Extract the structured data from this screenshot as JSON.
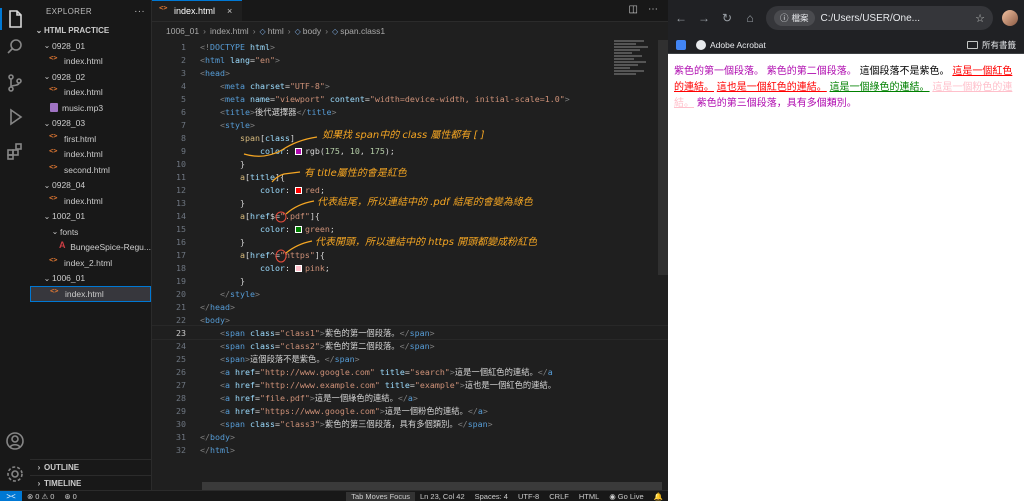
{
  "explorer": {
    "title": "EXPLORER",
    "more": "···",
    "workspace": "HTML PRACTICE",
    "tree": [
      {
        "label": "0928_01",
        "type": "folder",
        "indent": 1
      },
      {
        "label": "index.html",
        "type": "html",
        "indent": 2
      },
      {
        "label": "0928_02",
        "type": "folder",
        "indent": 1
      },
      {
        "label": "index.html",
        "type": "html",
        "indent": 2
      },
      {
        "label": "music.mp3",
        "type": "music",
        "indent": 2
      },
      {
        "label": "0928_03",
        "type": "folder",
        "indent": 1
      },
      {
        "label": "first.html",
        "type": "html",
        "indent": 2
      },
      {
        "label": "index.html",
        "type": "html",
        "indent": 2
      },
      {
        "label": "second.html",
        "type": "html",
        "indent": 2
      },
      {
        "label": "0928_04",
        "type": "folder",
        "indent": 1
      },
      {
        "label": "index.html",
        "type": "html",
        "indent": 2
      },
      {
        "label": "1002_01",
        "type": "folder",
        "indent": 1
      },
      {
        "label": "fonts",
        "type": "folder",
        "indent": 2
      },
      {
        "label": "BungeeSpice-Regu...",
        "type": "font",
        "indent": 3
      },
      {
        "label": "index_2.html",
        "type": "html",
        "indent": 2
      },
      {
        "label": "1006_01",
        "type": "folder",
        "indent": 1
      },
      {
        "label": "index.html",
        "type": "html",
        "indent": 2,
        "selected": true
      }
    ],
    "outline": "OUTLINE",
    "timeline": "TIMELINE"
  },
  "editor": {
    "tab_label": "index.html",
    "tab_close": "×",
    "breadcrumb": [
      "1006_01",
      "index.html",
      "html",
      "body",
      "span.class1"
    ],
    "current_line": 23,
    "lines": [
      [
        [
          "t-br",
          "<!"
        ],
        [
          "t-tag",
          "DOCTYPE"
        ],
        [
          "t-attr",
          " html"
        ],
        [
          "t-br",
          ">"
        ]
      ],
      [
        [
          "t-br",
          "<"
        ],
        [
          "t-tag",
          "html"
        ],
        [
          "t-attr",
          " lang"
        ],
        [
          "t-txt",
          "="
        ],
        [
          "t-str",
          "\"en\""
        ],
        [
          "t-br",
          ">"
        ]
      ],
      [
        [
          "t-br",
          "<"
        ],
        [
          "t-tag",
          "head"
        ],
        [
          "t-br",
          ">"
        ]
      ],
      [
        [
          "t-txt",
          "    "
        ],
        [
          "t-br",
          "<"
        ],
        [
          "t-tag",
          "meta"
        ],
        [
          "t-attr",
          " charset"
        ],
        [
          "t-txt",
          "="
        ],
        [
          "t-str",
          "\"UTF-8\""
        ],
        [
          "t-br",
          ">"
        ]
      ],
      [
        [
          "t-txt",
          "    "
        ],
        [
          "t-br",
          "<"
        ],
        [
          "t-tag",
          "meta"
        ],
        [
          "t-attr",
          " name"
        ],
        [
          "t-txt",
          "="
        ],
        [
          "t-str",
          "\"viewport\""
        ],
        [
          "t-attr",
          " content"
        ],
        [
          "t-txt",
          "="
        ],
        [
          "t-str",
          "\"width=device-width, initial-scale=1.0\""
        ],
        [
          "t-br",
          ">"
        ]
      ],
      [
        [
          "t-txt",
          "    "
        ],
        [
          "t-br",
          "<"
        ],
        [
          "t-tag",
          "title"
        ],
        [
          "t-br",
          ">"
        ],
        [
          "t-txt",
          "後代選擇器"
        ],
        [
          "t-br",
          "</"
        ],
        [
          "t-tag",
          "title"
        ],
        [
          "t-br",
          ">"
        ]
      ],
      [
        [
          "t-txt",
          "    "
        ],
        [
          "t-br",
          "<"
        ],
        [
          "t-tag",
          "style"
        ],
        [
          "t-br",
          ">"
        ]
      ],
      [
        [
          "t-txt",
          "        "
        ],
        [
          "t-sel",
          "span"
        ],
        [
          "t-txt",
          "["
        ],
        [
          "t-attr",
          "class"
        ],
        [
          "t-txt",
          "]"
        ]
      ],
      [
        [
          "t-txt",
          "            "
        ],
        [
          "t-prop",
          "color"
        ],
        [
          "t-txt",
          ": "
        ],
        [
          "swatch",
          "#af0aaf"
        ],
        [
          "t-txt",
          "rgb("
        ],
        [
          "t-num",
          "175"
        ],
        [
          "t-txt",
          ", "
        ],
        [
          "t-num",
          "10"
        ],
        [
          "t-txt",
          ", "
        ],
        [
          "t-num",
          "175"
        ],
        [
          "t-txt",
          ");"
        ]
      ],
      [
        [
          "t-txt",
          "        }"
        ]
      ],
      [
        [
          "t-txt",
          "        "
        ],
        [
          "t-sel",
          "a"
        ],
        [
          "t-txt",
          "["
        ],
        [
          "t-attr",
          "title"
        ],
        [
          "t-txt",
          "]{"
        ]
      ],
      [
        [
          "t-txt",
          "            "
        ],
        [
          "t-prop",
          "color"
        ],
        [
          "t-txt",
          ": "
        ],
        [
          "swatch",
          "#ff0000"
        ],
        [
          "t-str",
          "red"
        ],
        [
          "t-txt",
          ";"
        ]
      ],
      [
        [
          "t-txt",
          "        }"
        ]
      ],
      [
        [
          "t-txt",
          "        "
        ],
        [
          "t-sel",
          "a"
        ],
        [
          "t-txt",
          "["
        ],
        [
          "t-attr",
          "href"
        ],
        [
          "t-txt",
          "$="
        ],
        [
          "t-str",
          "\".pdf\""
        ],
        [
          "t-txt",
          "]{"
        ]
      ],
      [
        [
          "t-txt",
          "            "
        ],
        [
          "t-prop",
          "color"
        ],
        [
          "t-txt",
          ": "
        ],
        [
          "swatch",
          "#008000"
        ],
        [
          "t-str",
          "green"
        ],
        [
          "t-txt",
          ";"
        ]
      ],
      [
        [
          "t-txt",
          "        }"
        ]
      ],
      [
        [
          "t-txt",
          "        "
        ],
        [
          "t-sel",
          "a"
        ],
        [
          "t-txt",
          "["
        ],
        [
          "t-attr",
          "href"
        ],
        [
          "t-txt",
          "^="
        ],
        [
          "t-str",
          "\"https\""
        ],
        [
          "t-txt",
          "]{"
        ]
      ],
      [
        [
          "t-txt",
          "            "
        ],
        [
          "t-prop",
          "color"
        ],
        [
          "t-txt",
          ": "
        ],
        [
          "swatch",
          "#ffc0cb"
        ],
        [
          "t-str",
          "pink"
        ],
        [
          "t-txt",
          ";"
        ]
      ],
      [
        [
          "t-txt",
          "        }"
        ]
      ],
      [
        [
          "t-txt",
          "    "
        ],
        [
          "t-br",
          "</"
        ],
        [
          "t-tag",
          "style"
        ],
        [
          "t-br",
          ">"
        ]
      ],
      [
        [
          "t-br",
          "</"
        ],
        [
          "t-tag",
          "head"
        ],
        [
          "t-br",
          ">"
        ]
      ],
      [
        [
          "t-br",
          "<"
        ],
        [
          "t-tag",
          "body"
        ],
        [
          "t-br",
          ">"
        ]
      ],
      [
        [
          "t-txt",
          "    "
        ],
        [
          "t-br",
          "<"
        ],
        [
          "t-tag",
          "span"
        ],
        [
          "t-attr",
          " class"
        ],
        [
          "t-txt",
          "="
        ],
        [
          "t-str",
          "\"class1\""
        ],
        [
          "t-br",
          ">"
        ],
        [
          "t-txt",
          "紫色的第一個段落。"
        ],
        [
          "t-br",
          "</"
        ],
        [
          "t-tag",
          "span"
        ],
        [
          "t-br",
          ">"
        ]
      ],
      [
        [
          "t-txt",
          "    "
        ],
        [
          "t-br",
          "<"
        ],
        [
          "t-tag",
          "span"
        ],
        [
          "t-attr",
          " class"
        ],
        [
          "t-txt",
          "="
        ],
        [
          "t-str",
          "\"class2\""
        ],
        [
          "t-br",
          ">"
        ],
        [
          "t-txt",
          "紫色的第二個段落。"
        ],
        [
          "t-br",
          "</"
        ],
        [
          "t-tag",
          "span"
        ],
        [
          "t-br",
          ">"
        ]
      ],
      [
        [
          "t-txt",
          "    "
        ],
        [
          "t-br",
          "<"
        ],
        [
          "t-tag",
          "span"
        ],
        [
          "t-br",
          ">"
        ],
        [
          "t-txt",
          "這個段落不是紫色。"
        ],
        [
          "t-br",
          "</"
        ],
        [
          "t-tag",
          "span"
        ],
        [
          "t-br",
          ">"
        ]
      ],
      [
        [
          "t-txt",
          "    "
        ],
        [
          "t-br",
          "<"
        ],
        [
          "t-tag",
          "a"
        ],
        [
          "t-attr",
          " href"
        ],
        [
          "t-txt",
          "="
        ],
        [
          "t-str",
          "\"http://www.google.com\""
        ],
        [
          "t-attr",
          " title"
        ],
        [
          "t-txt",
          "="
        ],
        [
          "t-str",
          "\"search\""
        ],
        [
          "t-br",
          ">"
        ],
        [
          "t-txt",
          "這是一個紅色的連結。"
        ],
        [
          "t-br",
          "</"
        ],
        [
          "t-tag",
          "a"
        ]
      ],
      [
        [
          "t-txt",
          "    "
        ],
        [
          "t-br",
          "<"
        ],
        [
          "t-tag",
          "a"
        ],
        [
          "t-attr",
          " href"
        ],
        [
          "t-txt",
          "="
        ],
        [
          "t-str",
          "\"http://www.example.com\""
        ],
        [
          "t-attr",
          " title"
        ],
        [
          "t-txt",
          "="
        ],
        [
          "t-str",
          "\"example\""
        ],
        [
          "t-br",
          ">"
        ],
        [
          "t-txt",
          "這也是一個紅色的連結。"
        ]
      ],
      [
        [
          "t-txt",
          "    "
        ],
        [
          "t-br",
          "<"
        ],
        [
          "t-tag",
          "a"
        ],
        [
          "t-attr",
          " href"
        ],
        [
          "t-txt",
          "="
        ],
        [
          "t-str",
          "\"file.pdf\""
        ],
        [
          "t-br",
          ">"
        ],
        [
          "t-txt",
          "這是一個綠色的連結。"
        ],
        [
          "t-br",
          "</"
        ],
        [
          "t-tag",
          "a"
        ],
        [
          "t-br",
          ">"
        ]
      ],
      [
        [
          "t-txt",
          "    "
        ],
        [
          "t-br",
          "<"
        ],
        [
          "t-tag",
          "a"
        ],
        [
          "t-attr",
          " href"
        ],
        [
          "t-txt",
          "="
        ],
        [
          "t-str",
          "\"https://www.google.com\""
        ],
        [
          "t-br",
          ">"
        ],
        [
          "t-txt",
          "這是一個粉色的連結。"
        ],
        [
          "t-br",
          "</"
        ],
        [
          "t-tag",
          "a"
        ],
        [
          "t-br",
          ">"
        ]
      ],
      [
        [
          "t-txt",
          "    "
        ],
        [
          "t-br",
          "<"
        ],
        [
          "t-tag",
          "span"
        ],
        [
          "t-attr",
          " class"
        ],
        [
          "t-txt",
          "="
        ],
        [
          "t-str",
          "\"class3\""
        ],
        [
          "t-br",
          ">"
        ],
        [
          "t-txt",
          "紫色的第三個段落，具有多個類別。"
        ],
        [
          "t-br",
          "</"
        ],
        [
          "t-tag",
          "span"
        ],
        [
          "t-br",
          ">"
        ]
      ],
      [
        [
          "t-br",
          "</"
        ],
        [
          "t-tag",
          "body"
        ],
        [
          "t-br",
          ">"
        ]
      ],
      [
        [
          "t-br",
          "</"
        ],
        [
          "t-tag",
          "html"
        ],
        [
          "t-br",
          ">"
        ]
      ]
    ],
    "annotations": [
      "如果找 span中的 class 屬性都有 [ ]",
      "有 title屬性的會是紅色",
      "代表結尾，所以連結中的 .pdf 結尾的會變為綠色",
      "代表開頭，所以連結中的 https 開頭都變成粉紅色"
    ]
  },
  "status": {
    "remote_icon": "><",
    "errors": "0",
    "warnings": "0",
    "ports": "0",
    "tab_moves_focus": "Tab Moves Focus",
    "position": "Ln 23, Col 42",
    "spaces": "Spaces: 4",
    "encoding": "UTF-8",
    "eol": "CRLF",
    "language": "HTML",
    "golive": "Go Live"
  },
  "browser": {
    "chip_label": "檔案",
    "url": "C:/Users/USER/One...",
    "bookmark_acrobat": "Adobe Acrobat",
    "bookmark_all": "所有書籤",
    "content": [
      {
        "text": "紫色的第一個段落。",
        "cls": "p-purple"
      },
      {
        "text": "紫色的第二個段落。",
        "cls": "p-purple"
      },
      {
        "text": "這個段落不是紫色。",
        "cls": ""
      },
      {
        "text": "這是一個紅色的連結。",
        "cls": "p-red"
      },
      {
        "text": "這也是一個紅色的連結。",
        "cls": "p-red"
      },
      {
        "text": "這是一個綠色的連結。",
        "cls": "p-green"
      },
      {
        "text": "這是一個粉色的連結。",
        "cls": "p-pink"
      },
      {
        "text": "紫色的第三個段落，具有多個類別。",
        "cls": "p-purple"
      }
    ]
  }
}
